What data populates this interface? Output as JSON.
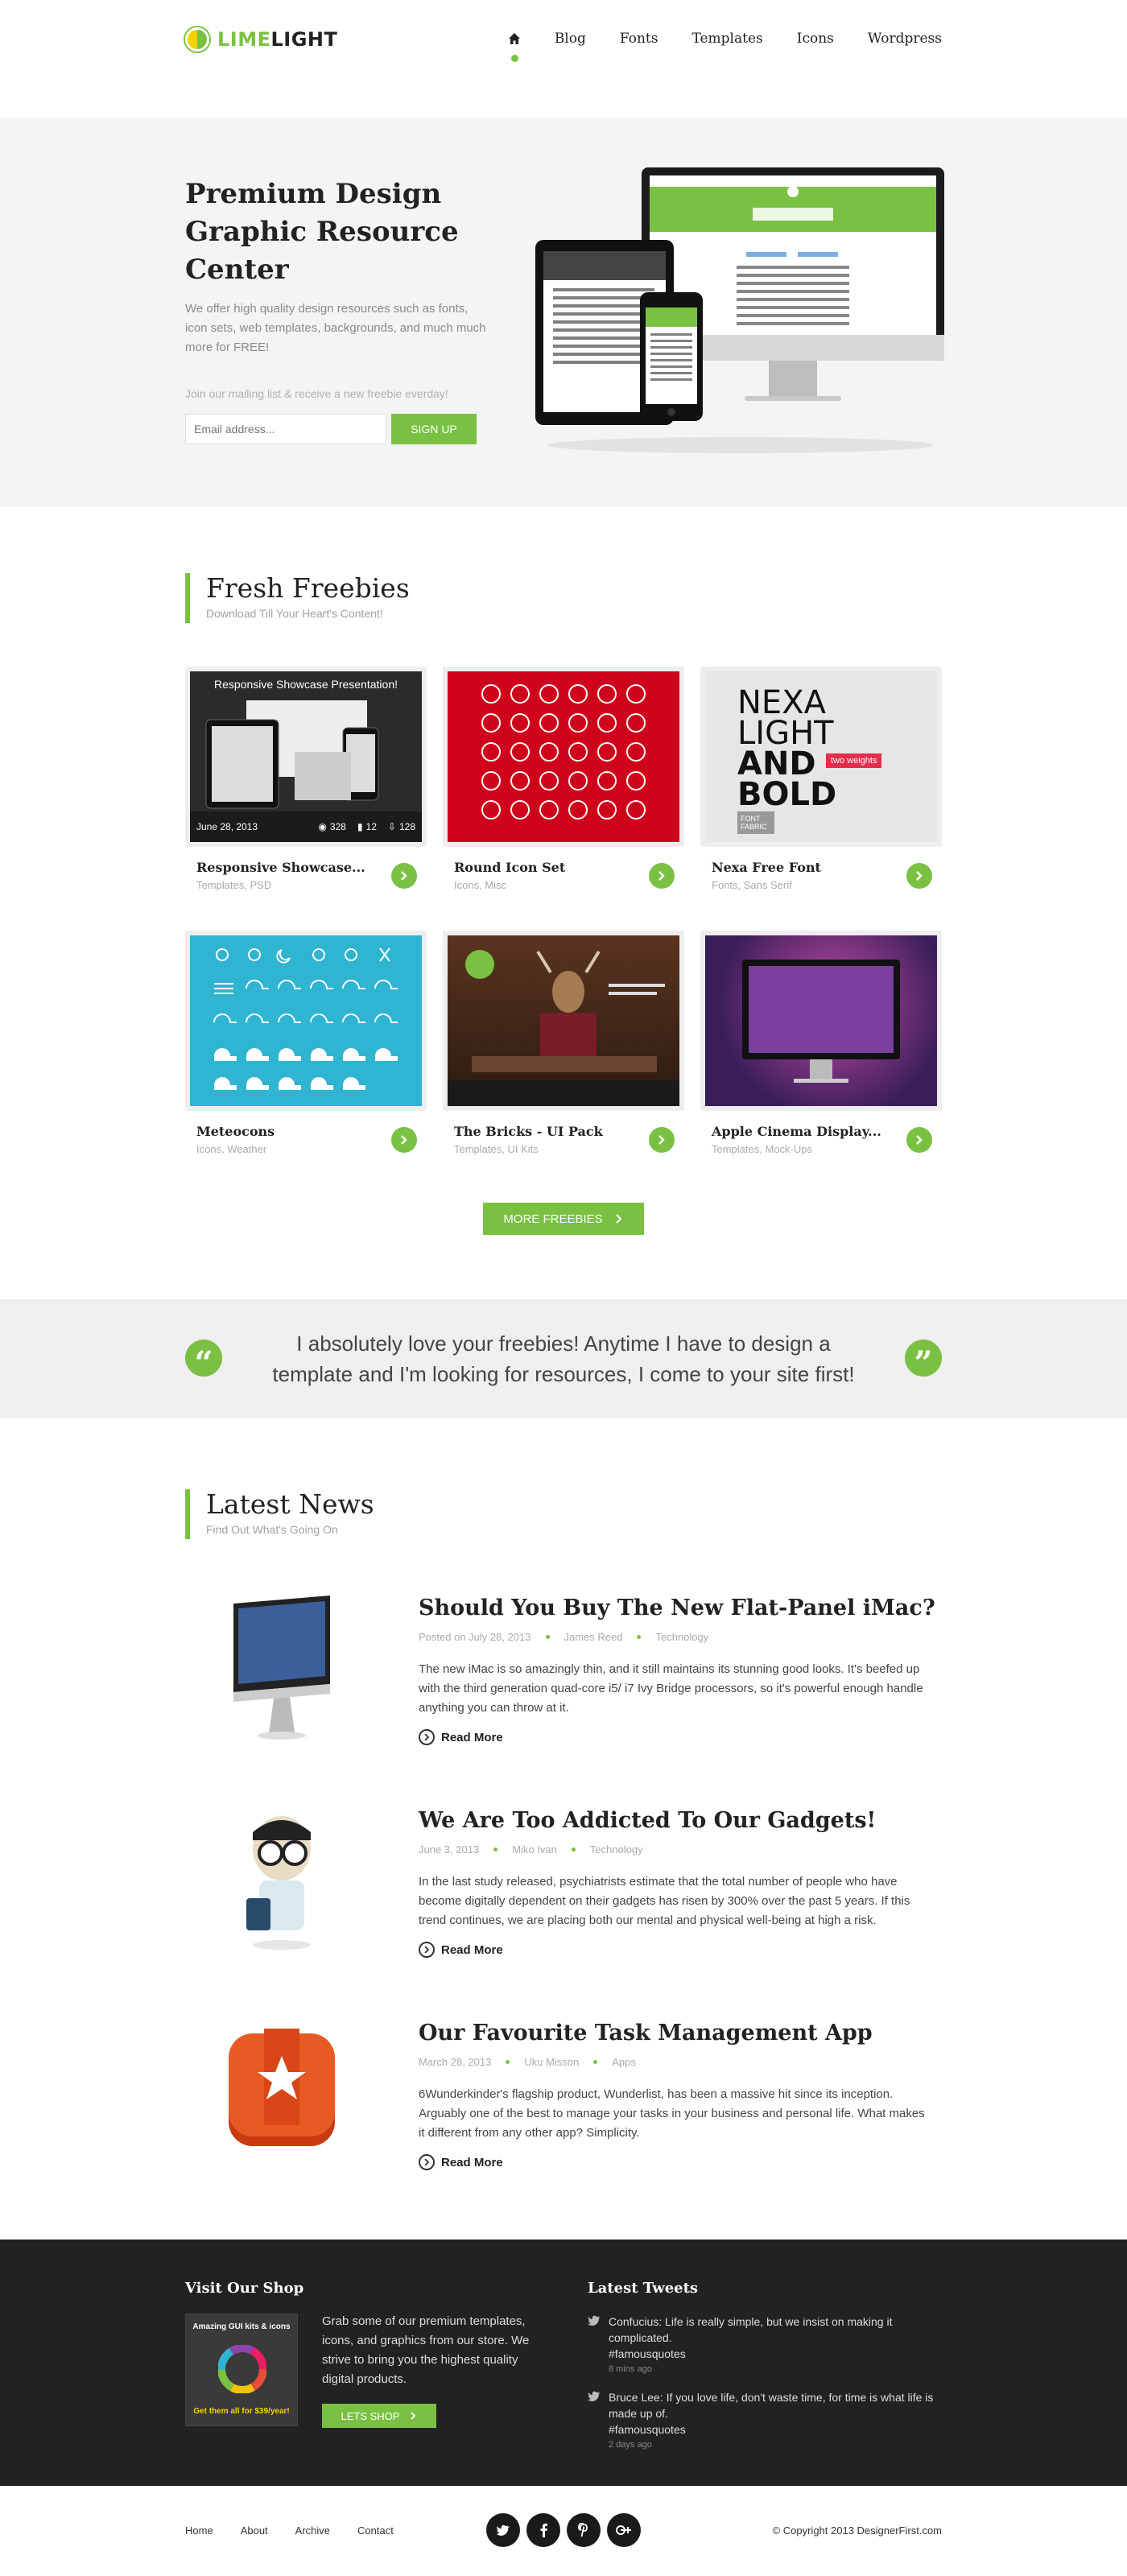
{
  "brand": {
    "lime": "LIME",
    "light": "LIGHT"
  },
  "nav": {
    "items": [
      "Blog",
      "Fonts",
      "Templates",
      "Icons",
      "Wordpress"
    ]
  },
  "hero": {
    "title": "Premium Design Graphic Resource Center",
    "description": "We offer high quality design resources such as fonts, icon sets, web templates, backgrounds, and much much more for FREE!",
    "mailing_label": "Join our mailing list & receive a new freebie everday!",
    "email_placeholder": "Email address...",
    "signup_label": "SIGN UP"
  },
  "freebies": {
    "title": "Fresh Freebies",
    "subtitle": "Download Till Your Heart's Content!",
    "showcase_banner": "Responsive Showcase Presentation!",
    "showcase_date": "June 28, 2013",
    "showcase_views": "328",
    "showcase_comments": "12",
    "showcase_downloads": "128",
    "nexa_lines": [
      "NEXA",
      "LIGHT",
      "AND",
      "BOLD"
    ],
    "nexa_tag": "two weights",
    "nexa_badge": "FONT FABRIC",
    "items": [
      {
        "title": "Responsive Showcase...",
        "category": "Templates, PSD"
      },
      {
        "title": "Round Icon Set",
        "category": "Icons, Misc"
      },
      {
        "title": "Nexa Free Font",
        "category": "Fonts, Sans Serif"
      },
      {
        "title": "Meteocons",
        "category": "Icons, Weather"
      },
      {
        "title": "The Bricks - UI Pack",
        "category": "Templates, UI Kits"
      },
      {
        "title": "Apple Cinema Display...",
        "category": "Templates, Mock-Ups"
      }
    ],
    "more_label": "MORE FREEBIES"
  },
  "testimonial": {
    "text": "I absolutely love your freebies! Anytime I have to design a template and I'm looking for resources, I come to your site first!"
  },
  "news": {
    "title": "Latest News",
    "subtitle": "Find Out What's Going On",
    "read_more": "Read More",
    "posts": [
      {
        "title": "Should You Buy The New Flat-Panel iMac?",
        "date": "Posted on July 28, 2013",
        "author": "James Reed",
        "category": "Technology",
        "body": "The new iMac is so amazingly thin, and it still maintains its stunning good looks. It's beefed up with the third generation quad-core i5/ i7 Ivy Bridge processors, so it's powerful enough handle anything you can throw at it."
      },
      {
        "title": "We Are Too Addicted To Our Gadgets!",
        "date": "June 3, 2013",
        "author": "Miko Ivan",
        "category": "Technology",
        "body": "In the last study released, psychiatrists estimate that the total number of people who have become digitally dependent on their gadgets has risen by 300% over the past 5 years. If this trend continues, we are placing both our mental and physical well-being at high a risk."
      },
      {
        "title": "Our Favourite Task Management App",
        "date": "March 28, 2013",
        "author": "Uku Misson",
        "category": "Apps",
        "body": "6Wunderkinder's flagship product, Wunderlist, has been a massive hit since its inception. Arguably one of the best to manage your tasks in your business and personal life. What makes it different from any other app? Simplicity."
      }
    ]
  },
  "footer": {
    "shop_title": "Visit Our Shop",
    "shop_img_top": "Amazing GUI kits & icons",
    "shop_img_bottom": "Get them all for $39/year!",
    "shop_desc": "Grab some of our premium templates, icons, and graphics from our store. We strive to bring you the highest quality digital products.",
    "shop_button": "LETS SHOP",
    "tweets_title": "Latest Tweets",
    "tweets": [
      {
        "text": "Confucius: Life is really simple, but we insist on making it complicated.",
        "tag": "#famousquotes",
        "time": "8 mins ago"
      },
      {
        "text": "Bruce Lee: If you love life, don't waste time, for time is what life is made up of.",
        "tag": "#famousquotes",
        "time": "2 days ago"
      }
    ],
    "links": [
      "Home",
      "About",
      "Archive",
      "Contact"
    ],
    "copyright": "© Copyright 2013 DesignerFirst.com"
  },
  "colors": {
    "accent": "#7ac143",
    "dark": "#222222",
    "hero_bg": "#f4f4f4"
  }
}
